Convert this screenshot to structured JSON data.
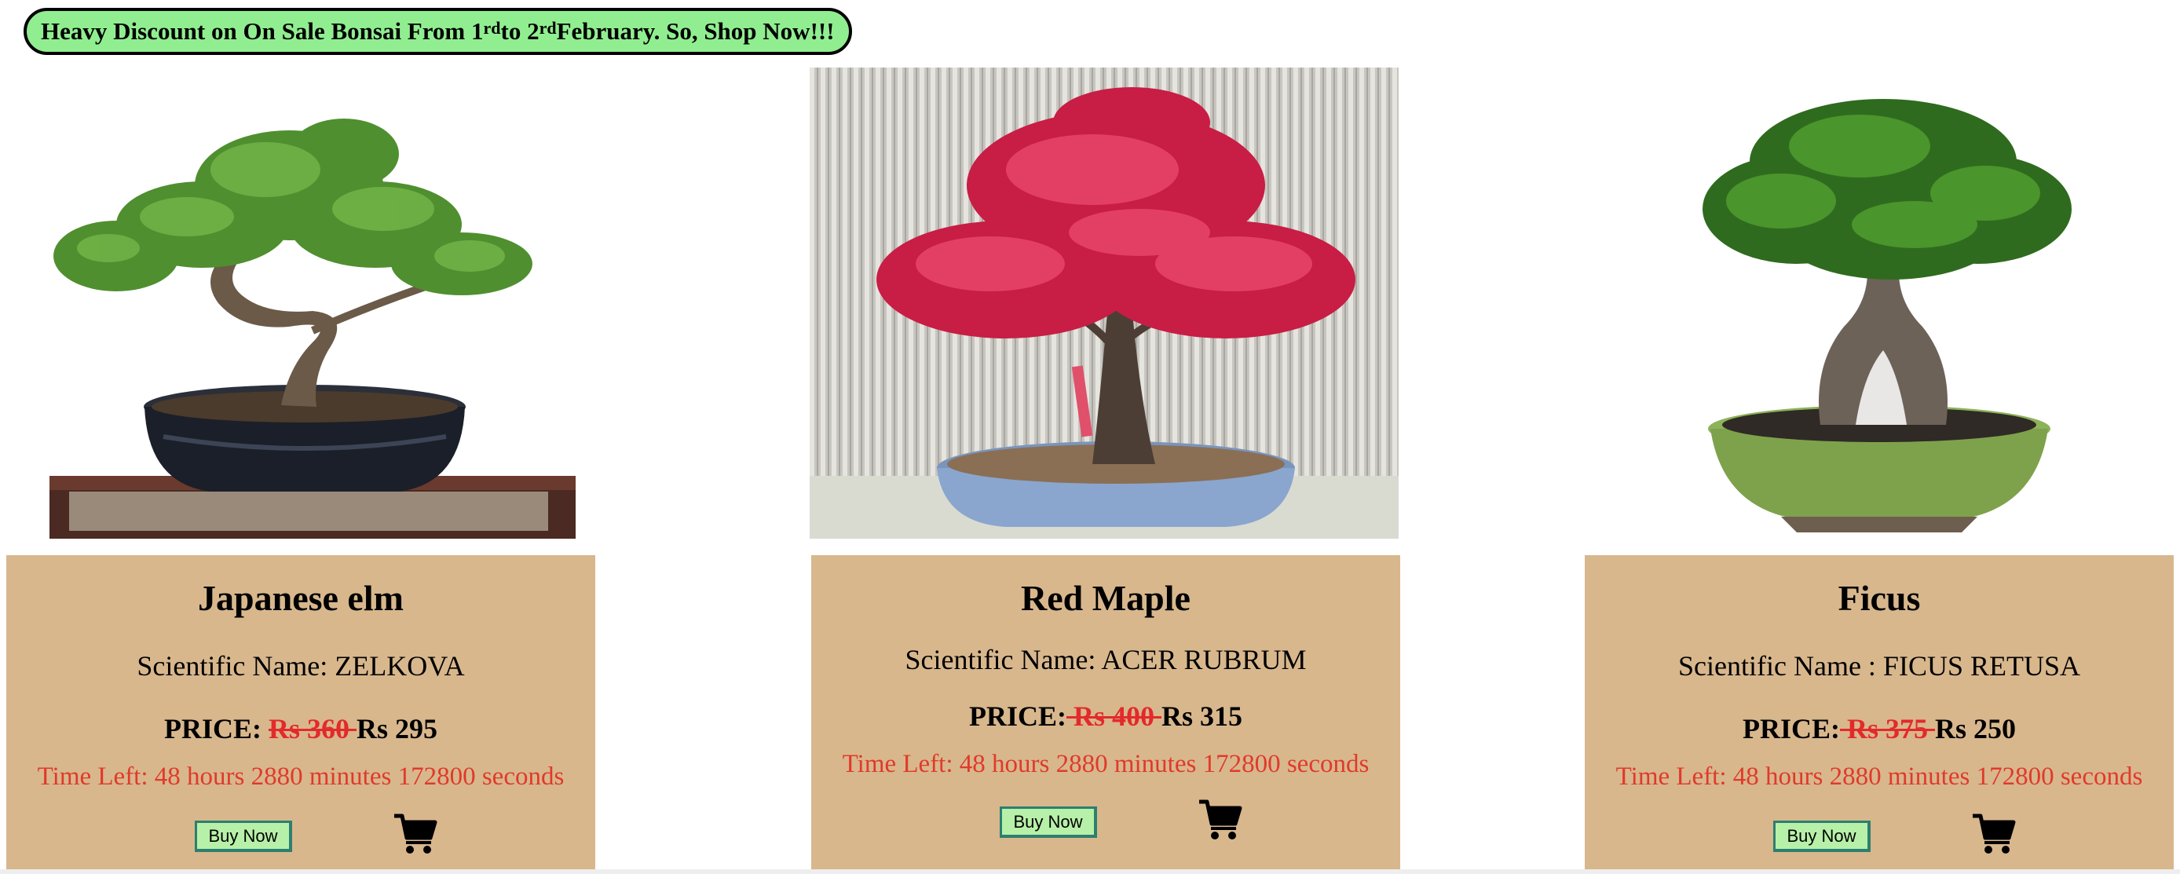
{
  "banner": {
    "prefix": "Heavy Discount on On Sale Bonsai From 1",
    "sup1": "rd",
    "mid": " to 2",
    "sup2": "rd",
    "suffix": " February. So, Shop Now!!!"
  },
  "products": [
    {
      "name": "Japanese elm",
      "scientific": "Scientific Name: ZELKOVA",
      "price_label": "PRICE:",
      "old_price": "Rs 360 ",
      "new_price": "Rs 295",
      "time_left": "Time Left: 48 hours 2880 minutes 172800 seconds",
      "buy_label": "Buy Now"
    },
    {
      "name": "Red Maple",
      "scientific": "Scientific Name: ACER RUBRUM",
      "price_label": "PRICE:",
      "old_price": " Rs 400 ",
      "new_price": "Rs 315",
      "time_left": "Time Left: 48 hours 2880 minutes 172800 seconds",
      "buy_label": "Buy Now"
    },
    {
      "name": "Ficus",
      "scientific": "Scientific Name : FICUS RETUSA",
      "price_label": "PRICE:",
      "old_price": " Rs 375 ",
      "new_price": "Rs 250",
      "time_left": "Time Left: 48 hours 2880 minutes 172800 seconds",
      "buy_label": "Buy Now"
    }
  ],
  "colors": {
    "banner_bg": "#90ee90",
    "card_bg": "#d8b78d",
    "old_price": "#e32a2a",
    "time_left": "#e03a2a",
    "button_bg": "#b7f0a8"
  },
  "icons": {
    "cart": "shopping-cart-icon"
  }
}
